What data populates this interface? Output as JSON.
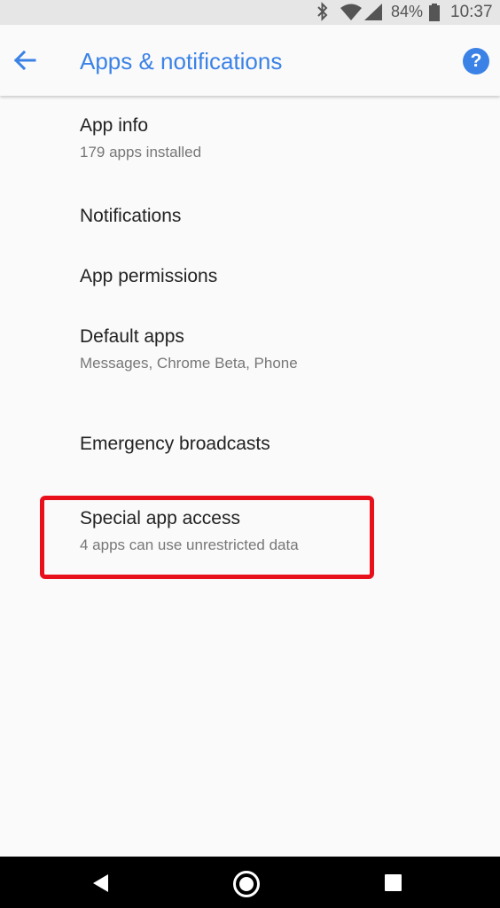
{
  "status_bar": {
    "battery_percent": "84%",
    "time": "10:37",
    "icons": [
      "bluetooth-icon",
      "wifi-icon",
      "cell-signal-icon",
      "battery-icon"
    ]
  },
  "app_bar": {
    "title": "Apps & notifications",
    "back_icon": "arrow-left-icon",
    "help_label": "?",
    "accent_color": "#3b82e6"
  },
  "items": [
    {
      "title": "App info",
      "subtitle": "179 apps installed"
    },
    {
      "title": "Notifications"
    },
    {
      "title": "App permissions"
    },
    {
      "title": "Default apps",
      "subtitle": "Messages, Chrome Beta, Phone"
    },
    {
      "title": "Emergency broadcasts"
    },
    {
      "title": "Special app access",
      "subtitle": "4 apps can use unrestricted data"
    }
  ],
  "highlight_color": "#e8101a",
  "nav_bar": {
    "icons": [
      "nav-back-icon",
      "nav-home-icon",
      "nav-recents-icon"
    ]
  }
}
